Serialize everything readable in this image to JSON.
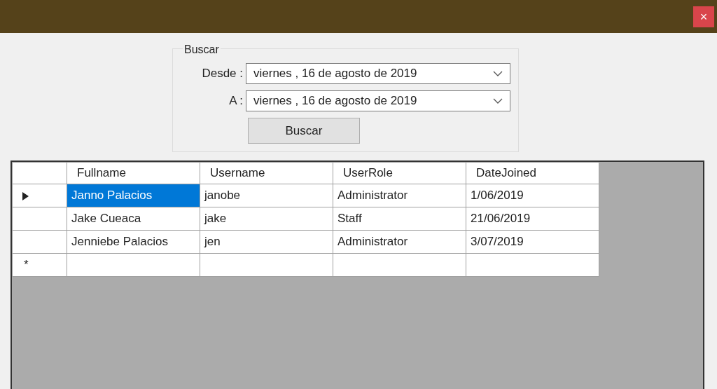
{
  "window": {
    "close_button": "×"
  },
  "search_group": {
    "title": "Buscar",
    "fields": [
      {
        "label": "Desde :",
        "value": "viernes , 16 de   agosto   de 2019"
      },
      {
        "label": "A :",
        "value": "viernes , 16 de   agosto   de 2019"
      }
    ],
    "button": "Buscar"
  },
  "table": {
    "columns": [
      "Fullname",
      "Username",
      "UserRole",
      "DateJoined"
    ],
    "rows": [
      {
        "current": true,
        "cells": [
          {
            "text": "Janno Palacios",
            "selected": true
          },
          {
            "text": "janobe",
            "selected": false
          },
          {
            "text": "Administrator",
            "selected": false
          },
          {
            "text": "1/06/2019",
            "selected": false
          }
        ]
      },
      {
        "current": false,
        "cells": [
          {
            "text": "Jake Cueaca",
            "selected": false
          },
          {
            "text": "jake",
            "selected": false
          },
          {
            "text": "Staff",
            "selected": false
          },
          {
            "text": "21/06/2019",
            "selected": false
          }
        ]
      },
      {
        "current": false,
        "cells": [
          {
            "text": "Jenniebe Palacios",
            "selected": false
          },
          {
            "text": "jen",
            "selected": false
          },
          {
            "text": "Administrator",
            "selected": false
          },
          {
            "text": "3/07/2019",
            "selected": false
          }
        ]
      }
    ],
    "new_row_marker": "*"
  }
}
